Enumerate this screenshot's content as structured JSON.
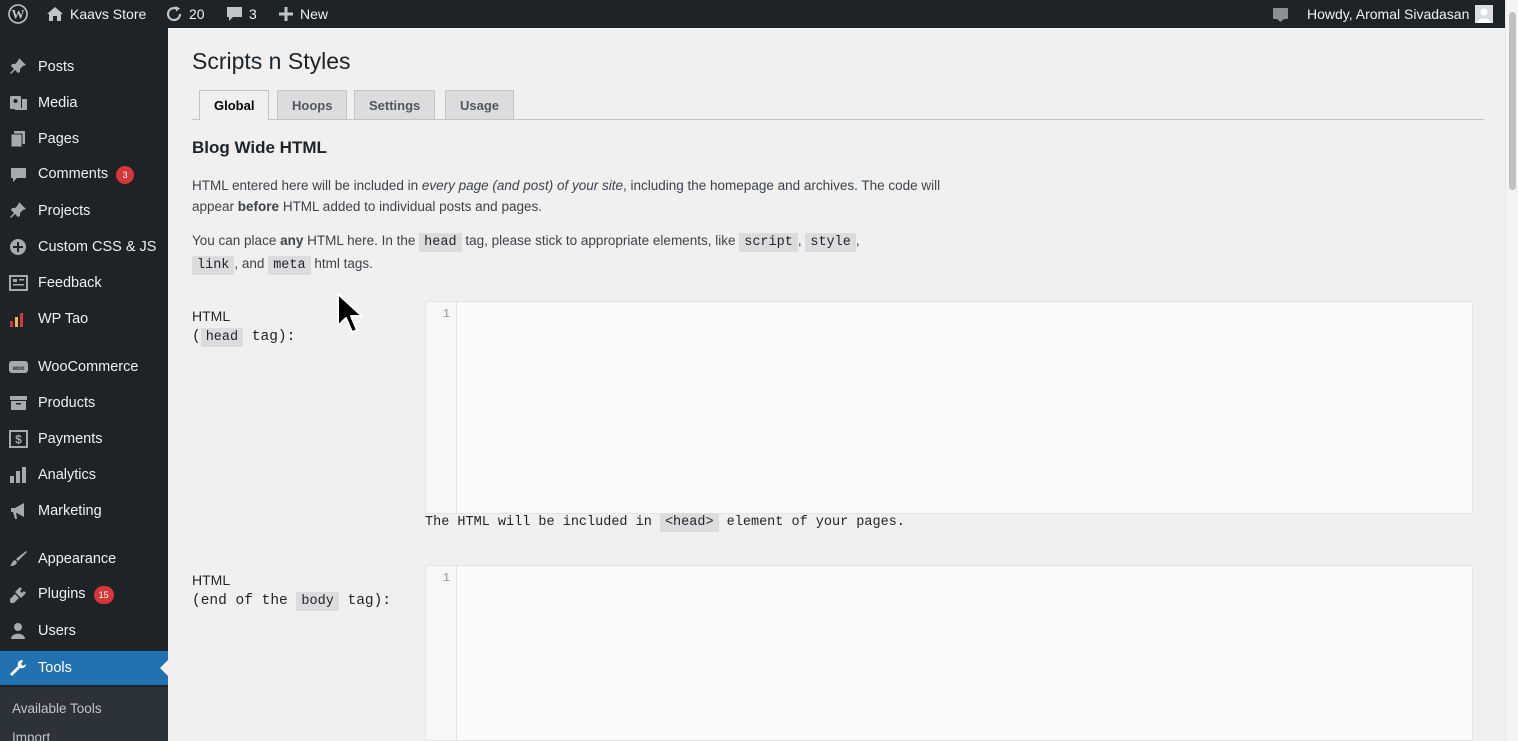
{
  "adminbar": {
    "site_name": "Kaavs Store",
    "updates_count": "20",
    "comments_count": "3",
    "new_label": "New",
    "howdy": "Howdy, Aromal Sivadasan",
    "icons": [
      "wordpress-logo",
      "home-icon",
      "updates-icon",
      "comment-icon",
      "plus-icon",
      "notification-icon",
      "avatar"
    ]
  },
  "sidebar": {
    "items": [
      {
        "label": "Posts",
        "icon": "pin-icon"
      },
      {
        "label": "Media",
        "icon": "media-icon"
      },
      {
        "label": "Pages",
        "icon": "pages-icon"
      },
      {
        "label": "Comments",
        "icon": "comment-icon",
        "badge": "3"
      },
      {
        "label": "Projects",
        "icon": "pin-icon"
      },
      {
        "label": "Custom CSS & JS",
        "icon": "plus-circle-icon"
      },
      {
        "label": "Feedback",
        "icon": "feedback-icon"
      },
      {
        "label": "WP Tao",
        "icon": "chart-icon"
      },
      {
        "label": "WooCommerce",
        "icon": "woo-icon"
      },
      {
        "label": "Products",
        "icon": "archive-icon"
      },
      {
        "label": "Payments",
        "icon": "dollar-icon"
      },
      {
        "label": "Analytics",
        "icon": "bar-chart-icon"
      },
      {
        "label": "Marketing",
        "icon": "megaphone-icon"
      },
      {
        "label": "Appearance",
        "icon": "brush-icon"
      },
      {
        "label": "Plugins",
        "icon": "plug-icon",
        "badge": "15"
      },
      {
        "label": "Users",
        "icon": "user-icon"
      },
      {
        "label": "Tools",
        "icon": "wrench-icon"
      }
    ],
    "submenu": [
      "Available Tools",
      "Import"
    ]
  },
  "main": {
    "page_title": "Scripts n Styles",
    "tabs": [
      "Global",
      "Hoops",
      "Settings",
      "Usage"
    ],
    "active_tab": "Global",
    "section_title": "Blog Wide HTML",
    "para1": {
      "a": "HTML entered here will be included in ",
      "em": "every page (and post) of your site",
      "b": ", including the homepage and archives. The code will appear ",
      "strong": "before",
      "c": " HTML added to individual posts and pages."
    },
    "para2": {
      "a": "You can place ",
      "strong": "any",
      "b": " HTML here. In the ",
      "code_head": "head",
      "c": " tag, please stick to appropriate elements, like ",
      "code_script": "script",
      "comma1": ", ",
      "code_style": "style",
      "comma2": ",",
      "code_link": "link",
      "d": ", and ",
      "code_meta": "meta",
      "e": " html tags."
    },
    "field1": {
      "label_line1": "HTML",
      "open": "(",
      "code": "head",
      "close": " tag):",
      "line_number": "1",
      "hint_a": "The HTML will be included in ",
      "hint_code": "<head>",
      "hint_b": " element of your pages."
    },
    "field2": {
      "label_line1": "HTML",
      "open": "(end of the ",
      "code": "body",
      "close": " tag):",
      "line_number": "1"
    }
  }
}
